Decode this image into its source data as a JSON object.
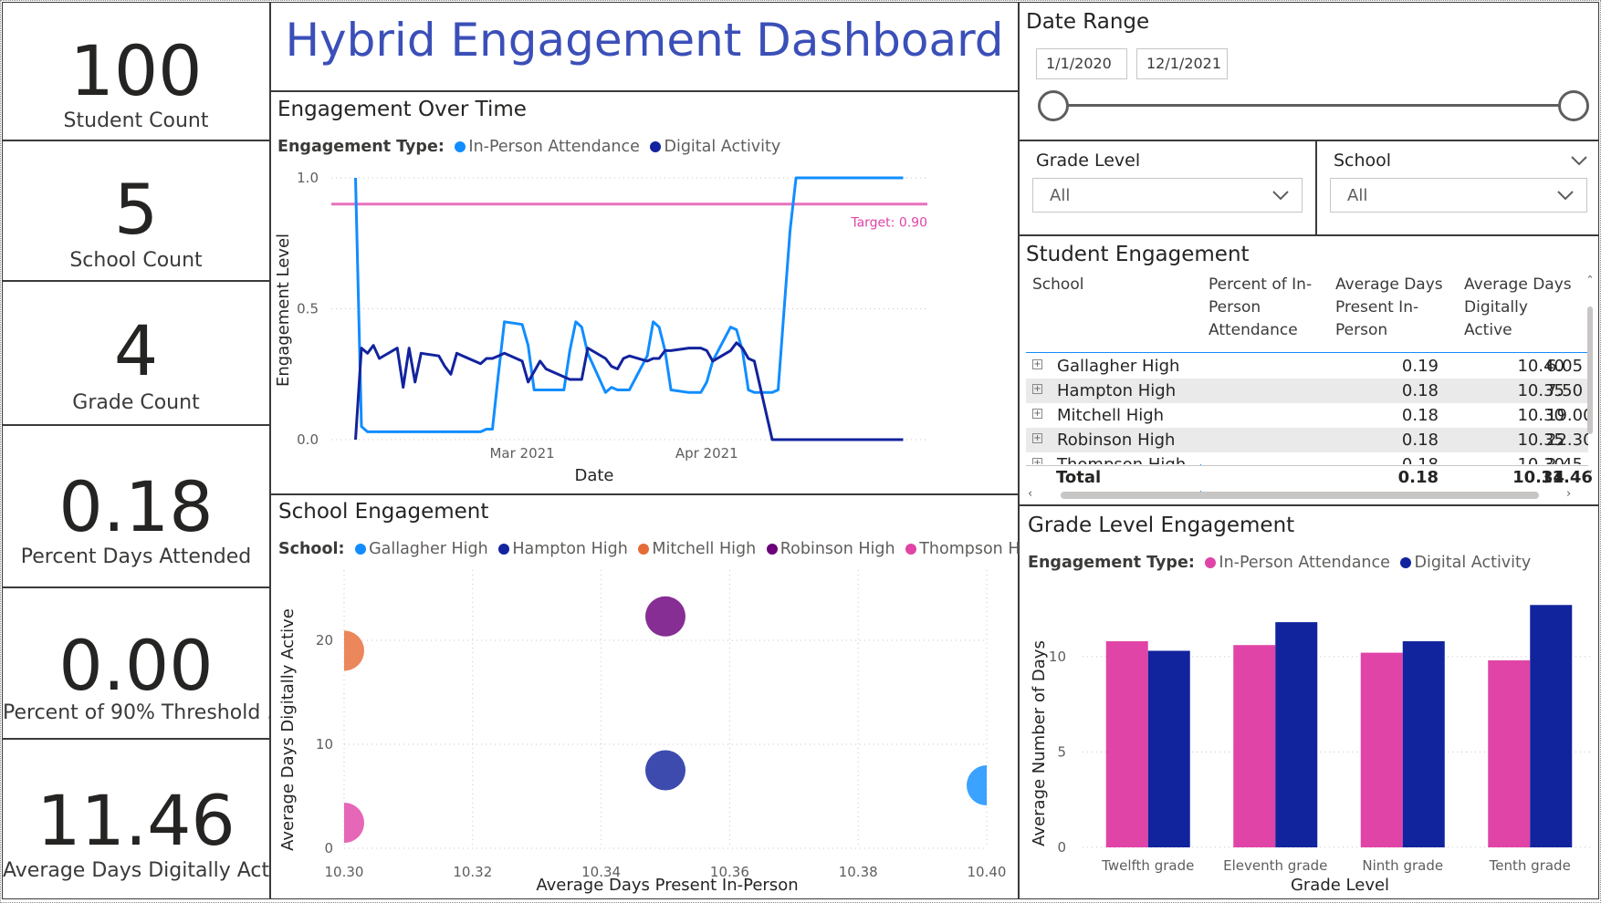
{
  "kpis": {
    "student_count": {
      "value": "100",
      "label": "Student Count"
    },
    "school_count": {
      "value": "5",
      "label": "School Count"
    },
    "grade_count": {
      "value": "4",
      "label": "Grade Count"
    },
    "percent_days_attended": {
      "value": "0.18",
      "label": "Percent Days Attended"
    },
    "percent_threshold": {
      "value": "0.00",
      "label": "Percent of 90% Threshold ..."
    },
    "avg_days_digital": {
      "value": "11.46",
      "label": "Average Days Digitally Active"
    }
  },
  "dashboard_title": "Hybrid Engagement Dashboard",
  "date_range": {
    "title": "Date Range",
    "start": "1/1/2020",
    "end": "12/1/2021"
  },
  "grade_filter": {
    "title": "Grade Level",
    "value": "All"
  },
  "school_filter": {
    "title": "School",
    "value": "All"
  },
  "engagement_chart": {
    "title": "Engagement Over Time",
    "legend_title": "Engagement Type:",
    "target_label": "Target: 0.90",
    "colors": {
      "in_person": "#118dff",
      "digital": "#12239e",
      "target": "#e044a7"
    }
  },
  "student_table": {
    "title": "Student Engagement",
    "columns": [
      "School",
      "Percent of In-Person Attendance",
      "Average Days Present In-Person",
      "Average Days Digitally Active"
    ],
    "rows": [
      {
        "school": "Gallagher High",
        "pct": "0.19",
        "present": "10.40",
        "digital": "6.05"
      },
      {
        "school": "Hampton High",
        "pct": "0.18",
        "present": "10.35",
        "digital": "7.50"
      },
      {
        "school": "Mitchell High",
        "pct": "0.18",
        "present": "10.30",
        "digital": "19.00"
      },
      {
        "school": "Robinson High",
        "pct": "0.18",
        "present": "10.35",
        "digital": "22.30"
      },
      {
        "school": "Thompson High",
        "pct": "0.18",
        "present": "10.30",
        "digital": "2.45"
      }
    ],
    "total": {
      "label": "Total",
      "pct": "0.18",
      "present": "10.34",
      "digital": "11.46"
    }
  },
  "school_chart": {
    "title": "School Engagement",
    "legend_title": "School:"
  },
  "grade_chart": {
    "title": "Grade Level Engagement",
    "legend_title": "Engagement Type:"
  },
  "chart_data": [
    {
      "type": "line",
      "title": "Engagement Over Time",
      "xlabel": "Date",
      "ylabel": "Engagement Level",
      "ylim": [
        0,
        1
      ],
      "x_ticks": [
        "Mar 2021",
        "Apr 2021"
      ],
      "y_ticks": [
        "0.0",
        "0.5",
        "1.0"
      ],
      "x_range": [
        "2021-01-31",
        "2021-05-05"
      ],
      "target": 0.9,
      "series": [
        {
          "name": "In-Person Attendance",
          "color": "#118dff",
          "x": [
            "2021-02-01",
            "2021-02-02",
            "2021-02-03",
            "2021-02-04",
            "2021-02-05",
            "2021-02-08",
            "2021-02-09",
            "2021-02-10",
            "2021-02-11",
            "2021-02-12",
            "2021-02-15",
            "2021-02-16",
            "2021-02-17",
            "2021-02-18",
            "2021-02-19",
            "2021-02-22",
            "2021-02-23",
            "2021-02-24",
            "2021-02-25",
            "2021-02-26",
            "2021-03-01",
            "2021-03-02",
            "2021-03-03",
            "2021-03-04",
            "2021-03-05",
            "2021-03-08",
            "2021-03-09",
            "2021-03-10",
            "2021-03-11",
            "2021-03-12",
            "2021-03-15",
            "2021-03-16",
            "2021-03-17",
            "2021-03-18",
            "2021-03-19",
            "2021-03-22",
            "2021-03-23",
            "2021-03-24",
            "2021-03-25",
            "2021-03-26",
            "2021-03-29",
            "2021-03-30",
            "2021-03-31",
            "2021-04-01",
            "2021-04-02",
            "2021-04-05",
            "2021-04-06",
            "2021-04-07",
            "2021-04-08",
            "2021-04-09",
            "2021-04-12",
            "2021-04-13",
            "2021-04-14",
            "2021-04-15",
            "2021-04-16",
            "2021-04-19",
            "2021-04-20",
            "2021-04-21",
            "2021-04-22",
            "2021-04-23",
            "2021-04-26",
            "2021-04-27",
            "2021-04-28",
            "2021-04-29",
            "2021-04-30",
            "2021-05-03",
            "2021-05-04"
          ],
          "values": [
            1.0,
            0.05,
            0.03,
            0.03,
            0.03,
            0.03,
            0.03,
            0.03,
            0.03,
            0.03,
            0.03,
            0.03,
            0.03,
            0.03,
            0.03,
            0.03,
            0.04,
            0.04,
            0.25,
            0.45,
            0.44,
            0.36,
            0.19,
            0.19,
            0.19,
            0.19,
            0.34,
            0.45,
            0.43,
            0.33,
            0.18,
            0.2,
            0.19,
            0.19,
            0.19,
            0.32,
            0.45,
            0.43,
            0.34,
            0.19,
            0.18,
            0.18,
            0.18,
            0.22,
            0.3,
            0.43,
            0.42,
            0.34,
            0.19,
            0.18,
            0.18,
            0.19,
            0.5,
            0.8,
            1.0,
            1.0,
            1.0,
            1.0,
            1.0,
            1.0,
            1.0,
            1.0,
            1.0,
            1.0,
            1.0,
            1.0,
            1.0
          ]
        },
        {
          "name": "Digital Activity",
          "color": "#12239e",
          "x": [
            "2021-02-01",
            "2021-02-02",
            "2021-02-03",
            "2021-02-04",
            "2021-02-05",
            "2021-02-08",
            "2021-02-09",
            "2021-02-10",
            "2021-02-11",
            "2021-02-12",
            "2021-02-15",
            "2021-02-16",
            "2021-02-17",
            "2021-02-18",
            "2021-02-19",
            "2021-02-22",
            "2021-02-23",
            "2021-02-24",
            "2021-02-25",
            "2021-02-26",
            "2021-03-01",
            "2021-03-02",
            "2021-03-03",
            "2021-03-04",
            "2021-03-05",
            "2021-03-08",
            "2021-03-09",
            "2021-03-10",
            "2021-03-11",
            "2021-03-12",
            "2021-03-15",
            "2021-03-16",
            "2021-03-17",
            "2021-03-18",
            "2021-03-19",
            "2021-03-22",
            "2021-03-23",
            "2021-03-24",
            "2021-03-25",
            "2021-03-26",
            "2021-03-29",
            "2021-03-30",
            "2021-03-31",
            "2021-04-01",
            "2021-04-02",
            "2021-04-05",
            "2021-04-06",
            "2021-04-07",
            "2021-04-08",
            "2021-04-09",
            "2021-04-12",
            "2021-04-13",
            "2021-04-14",
            "2021-04-15",
            "2021-04-16",
            "2021-04-19",
            "2021-04-20",
            "2021-04-21",
            "2021-04-22",
            "2021-04-23",
            "2021-04-26",
            "2021-04-27",
            "2021-04-28",
            "2021-04-29",
            "2021-04-30",
            "2021-05-03",
            "2021-05-04"
          ],
          "values": [
            0.0,
            0.35,
            0.33,
            0.36,
            0.31,
            0.35,
            0.2,
            0.35,
            0.22,
            0.33,
            0.32,
            0.28,
            0.25,
            0.33,
            0.32,
            0.29,
            0.31,
            0.31,
            0.32,
            0.33,
            0.3,
            0.22,
            0.26,
            0.3,
            0.27,
            0.24,
            0.23,
            0.23,
            0.23,
            0.35,
            0.31,
            0.28,
            0.27,
            0.31,
            0.32,
            0.3,
            0.31,
            0.31,
            0.34,
            0.34,
            0.35,
            0.35,
            0.35,
            0.34,
            0.3,
            0.34,
            0.37,
            0.35,
            0.31,
            0.3,
            0.0,
            0.0,
            0.0,
            0.0,
            0.0,
            0.0,
            0.0,
            0.0,
            0.0,
            0.0,
            0.0,
            0.0,
            0.0,
            0.0,
            0.0,
            0.0,
            0.0
          ]
        },
        {
          "name": "Target",
          "color": "#e044a7",
          "constant": 0.9
        }
      ]
    },
    {
      "type": "scatter",
      "title": "School Engagement",
      "xlabel": "Average Days Present In-Person",
      "ylabel": "Average Days Digitally Active",
      "xlim": [
        10.3,
        10.4
      ],
      "ylim": [
        0,
        25
      ],
      "x_ticks": [
        "10.30",
        "10.32",
        "10.34",
        "10.36",
        "10.38",
        "10.40"
      ],
      "y_ticks": [
        "0",
        "10",
        "20"
      ],
      "series": [
        {
          "name": "Gallagher High",
          "color": "#118dff",
          "x": 10.4,
          "y": 6.05
        },
        {
          "name": "Hampton High",
          "color": "#12239e",
          "x": 10.35,
          "y": 7.5
        },
        {
          "name": "Mitchell High",
          "color": "#e66c37",
          "x": 10.3,
          "y": 19.0
        },
        {
          "name": "Robinson High",
          "color": "#6b007b",
          "x": 10.35,
          "y": 22.3
        },
        {
          "name": "Thompson High",
          "color": "#e044a7",
          "x": 10.3,
          "y": 2.45
        }
      ]
    },
    {
      "type": "bar",
      "title": "Grade Level Engagement",
      "xlabel": "Grade Level",
      "ylabel": "Average Number of Days",
      "ylim": [
        0,
        13
      ],
      "y_ticks": [
        "0",
        "5",
        "10"
      ],
      "categories": [
        "Twelfth grade",
        "Eleventh grade",
        "Ninth grade",
        "Tenth grade"
      ],
      "series": [
        {
          "name": "In-Person Attendance",
          "color": "#e044a7",
          "values": [
            10.8,
            10.6,
            10.2,
            9.8
          ]
        },
        {
          "name": "Digital Activity",
          "color": "#12239e",
          "values": [
            10.3,
            11.8,
            10.8,
            12.7
          ]
        }
      ]
    }
  ]
}
